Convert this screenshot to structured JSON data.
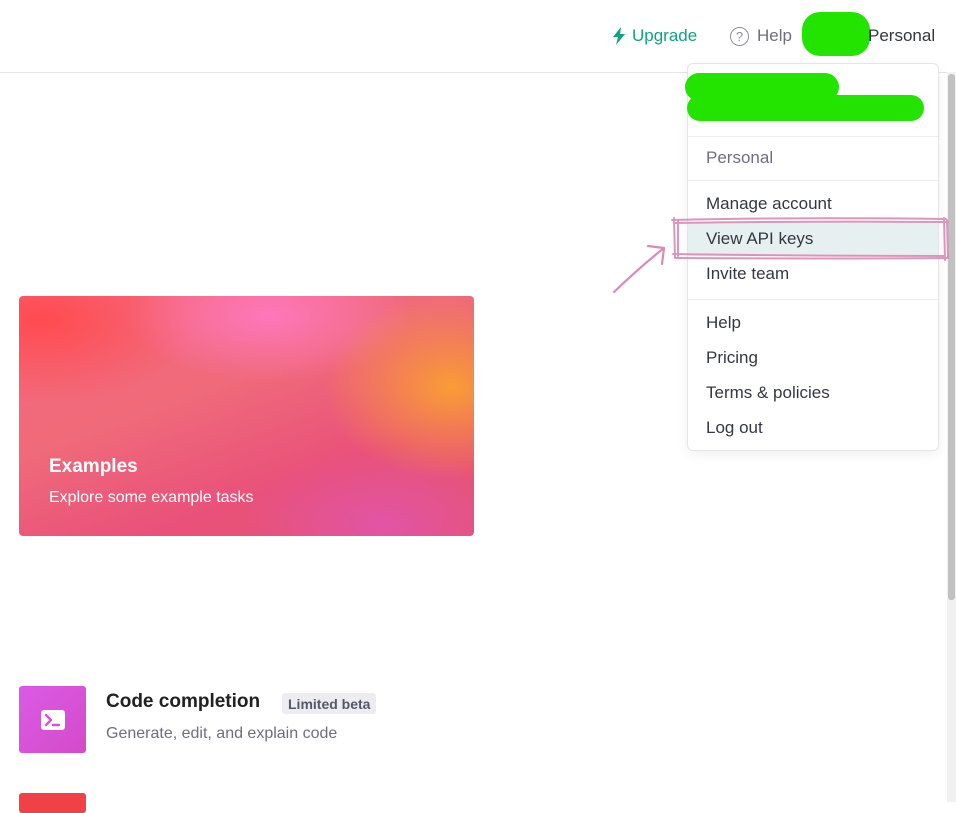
{
  "header": {
    "upgrade_label": "Upgrade",
    "help_label": "Help",
    "help_icon_glyph": "?",
    "account_label": "Personal"
  },
  "menu": {
    "org_label": "Personal",
    "account_items": [
      "Manage account",
      "View API keys",
      "Invite team"
    ],
    "help_items": [
      "Help",
      "Pricing",
      "Terms & policies",
      "Log out"
    ],
    "highlighted_item": "View API keys"
  },
  "examples_card": {
    "title": "Examples",
    "subtitle": "Explore some example tasks"
  },
  "code_completion": {
    "title": "Code completion",
    "badge": "Limited beta",
    "subtitle": "Generate, edit, and explain code"
  },
  "colors": {
    "accent": "#10a37f",
    "redaction": "#22e400",
    "annotation": "#d98bb5",
    "highlight_bg": "#e7f0f0"
  }
}
